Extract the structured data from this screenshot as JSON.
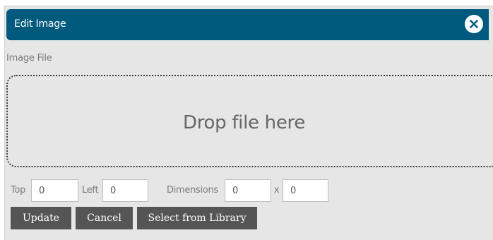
{
  "dialog": {
    "title": "Edit Image",
    "close_icon": "close-icon"
  },
  "image_file": {
    "label": "Image File",
    "drop_text": "Drop file here"
  },
  "position": {
    "top_label": "Top",
    "top_value": "0",
    "left_label": "Left",
    "left_value": "0"
  },
  "dimensions": {
    "label": "Dimensions",
    "width_value": "0",
    "separator": "x",
    "height_value": "0"
  },
  "buttons": {
    "update": "Update",
    "cancel": "Cancel",
    "library": "Select from Library"
  },
  "colors": {
    "title_bar": "#005a7e",
    "background": "#e6e6e6",
    "button": "#555555"
  }
}
